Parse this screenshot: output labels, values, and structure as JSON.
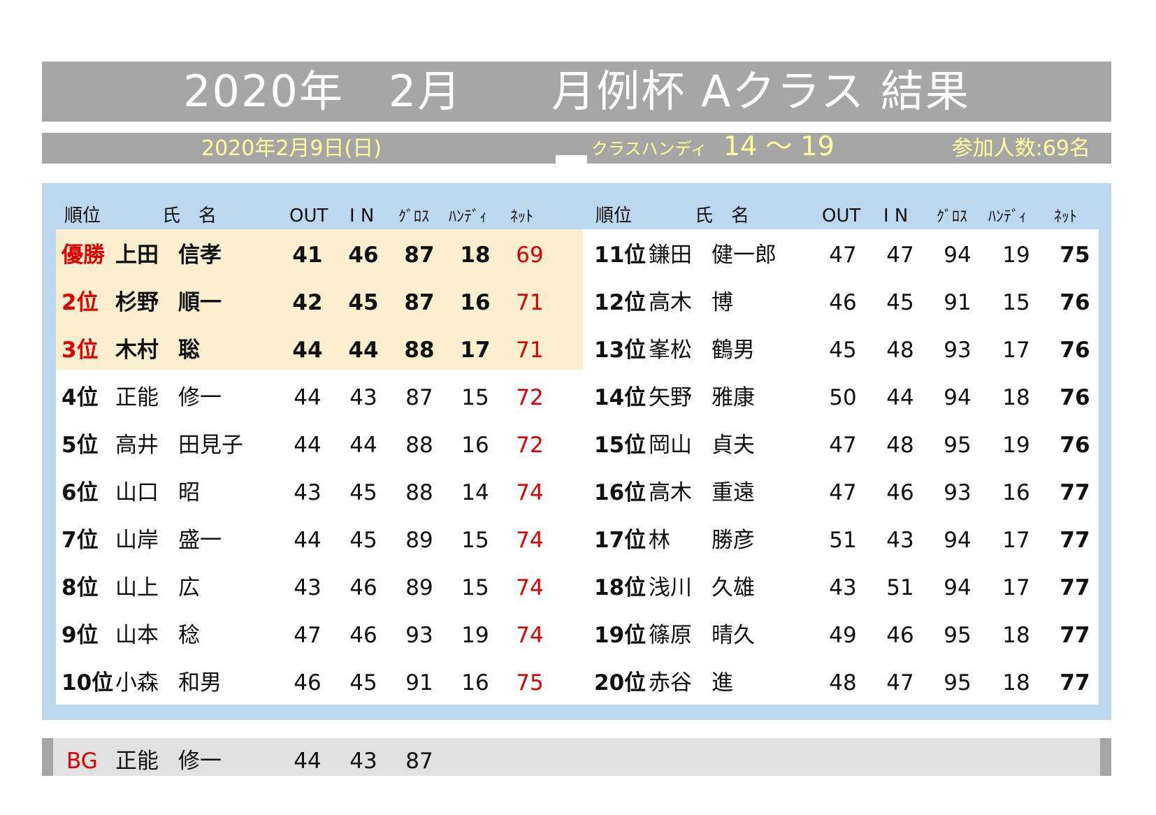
{
  "title": "2020年　2月　　月例杯 Aクラス 結果",
  "subheader": {
    "date": "2020年2月9日(日)",
    "handicap_label": "クラスハンディ",
    "handicap_range": "14 ～ 19",
    "participants": "参加人数:69名"
  },
  "headers": {
    "rank": "順位",
    "name": "氏　名",
    "out": "OUT",
    "in": "I N",
    "gross": "ｸﾞﾛｽ",
    "handicap": "ﾊﾝﾃﾞｨ",
    "net": "ﾈｯﾄ"
  },
  "rows_left": [
    {
      "rank": "優勝",
      "last": "上田",
      "first": "信孝",
      "out": "41",
      "in": "46",
      "gross": "87",
      "hdcp": "18",
      "net": "69"
    },
    {
      "rank": "2位",
      "last": "杉野",
      "first": "順一",
      "out": "42",
      "in": "45",
      "gross": "87",
      "hdcp": "16",
      "net": "71"
    },
    {
      "rank": "3位",
      "last": "木村",
      "first": "聡",
      "out": "44",
      "in": "44",
      "gross": "88",
      "hdcp": "17",
      "net": "71"
    },
    {
      "rank": "4位",
      "last": "正能",
      "first": "修一",
      "out": "44",
      "in": "43",
      "gross": "87",
      "hdcp": "15",
      "net": "72"
    },
    {
      "rank": "5位",
      "last": "高井",
      "first": "田見子",
      "out": "44",
      "in": "44",
      "gross": "88",
      "hdcp": "16",
      "net": "72"
    },
    {
      "rank": "6位",
      "last": "山口",
      "first": "昭",
      "out": "43",
      "in": "45",
      "gross": "88",
      "hdcp": "14",
      "net": "74"
    },
    {
      "rank": "7位",
      "last": "山岸",
      "first": "盛一",
      "out": "44",
      "in": "45",
      "gross": "89",
      "hdcp": "15",
      "net": "74"
    },
    {
      "rank": "8位",
      "last": "山上",
      "first": "広",
      "out": "43",
      "in": "46",
      "gross": "89",
      "hdcp": "15",
      "net": "74"
    },
    {
      "rank": "9位",
      "last": "山本",
      "first": "稔",
      "out": "47",
      "in": "46",
      "gross": "93",
      "hdcp": "19",
      "net": "74"
    },
    {
      "rank": "10位",
      "last": "小森",
      "first": "和男",
      "out": "46",
      "in": "45",
      "gross": "91",
      "hdcp": "16",
      "net": "75"
    }
  ],
  "rows_right": [
    {
      "rank": "11位",
      "last": "鎌田",
      "first": "健一郎",
      "out": "47",
      "in": "47",
      "gross": "94",
      "hdcp": "19",
      "net": "75"
    },
    {
      "rank": "12位",
      "last": "高木",
      "first": "博",
      "out": "46",
      "in": "45",
      "gross": "91",
      "hdcp": "15",
      "net": "76"
    },
    {
      "rank": "13位",
      "last": "峯松",
      "first": "鶴男",
      "out": "45",
      "in": "48",
      "gross": "93",
      "hdcp": "17",
      "net": "76"
    },
    {
      "rank": "14位",
      "last": "矢野",
      "first": "雅康",
      "out": "50",
      "in": "44",
      "gross": "94",
      "hdcp": "18",
      "net": "76"
    },
    {
      "rank": "15位",
      "last": "岡山",
      "first": "貞夫",
      "out": "47",
      "in": "48",
      "gross": "95",
      "hdcp": "19",
      "net": "76"
    },
    {
      "rank": "16位",
      "last": "高木",
      "first": "重遠",
      "out": "47",
      "in": "46",
      "gross": "93",
      "hdcp": "16",
      "net": "77"
    },
    {
      "rank": "17位",
      "last": "林",
      "first": "勝彦",
      "out": "51",
      "in": "43",
      "gross": "94",
      "hdcp": "17",
      "net": "77"
    },
    {
      "rank": "18位",
      "last": "浅川",
      "first": "久雄",
      "out": "43",
      "in": "51",
      "gross": "94",
      "hdcp": "17",
      "net": "77"
    },
    {
      "rank": "19位",
      "last": "篠原",
      "first": "晴久",
      "out": "49",
      "in": "46",
      "gross": "95",
      "hdcp": "18",
      "net": "77"
    },
    {
      "rank": "20位",
      "last": "赤谷",
      "first": "進",
      "out": "48",
      "in": "47",
      "gross": "95",
      "hdcp": "18",
      "net": "77"
    }
  ],
  "booby": {
    "label": "BG",
    "last": "正能",
    "first": "修一",
    "out": "44",
    "in": "43",
    "gross": "87"
  },
  "colors": {
    "banner_gray": "#a6a6a6",
    "panel_blue": "#bdd7ee",
    "top3_highlight": "#fcefcf",
    "date_yellow": "#ffff99",
    "accent_red": "#e00000"
  }
}
